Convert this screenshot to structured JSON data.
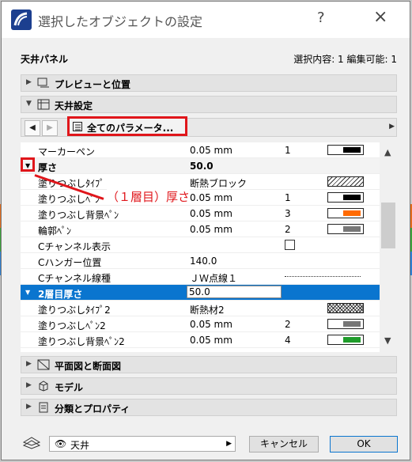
{
  "window": {
    "title": "選択したオブジェクトの設定",
    "help_label": "?",
    "close_label": "×"
  },
  "header": {
    "panel_name": "天井パネル",
    "selection_info": "選択内容: 1 編集可能: 1"
  },
  "sections": {
    "preview": "プレビューと位置",
    "ceiling_settings": "天井設定",
    "plan_section": "平面図と断面図",
    "model": "モデル",
    "classification": "分類とプロパティ"
  },
  "nav": {
    "all_params": "全てのパラメータ..."
  },
  "params": [
    {
      "name": "マーカーペン",
      "value": "0.05 mm",
      "num": "1",
      "swatch": "#000000"
    },
    {
      "name": "厚さ",
      "value": "50.0",
      "num": "",
      "swatch": ""
    },
    {
      "name": "塗りつぶしﾀｲﾌﾟ",
      "value": "断熱ブロック",
      "num": "",
      "swatch": "hatch"
    },
    {
      "name": "塗りつぶしﾍﾟﾝ",
      "value": "0.05 mm",
      "num": "1",
      "swatch": "#000000"
    },
    {
      "name": "塗りつぶし背景ﾍﾟﾝ",
      "value": "0.05 mm",
      "num": "3",
      "swatch": "#ff6a00"
    },
    {
      "name": "輪郭ﾍﾟﾝ",
      "value": "0.05 mm",
      "num": "2",
      "swatch": "#777777"
    },
    {
      "name": "Cチャンネル表示",
      "value": "",
      "num": "",
      "swatch": "checkbox"
    },
    {
      "name": "Cハンガー位置",
      "value": "140.0",
      "num": "",
      "swatch": ""
    },
    {
      "name": "Cチャンネル線種",
      "value": "ＪＷ点線１",
      "num": "",
      "swatch": "dots"
    },
    {
      "name": "2層目厚さ",
      "value": "50.0",
      "num": "",
      "swatch": ""
    },
    {
      "name": "塗りつぶしﾀｲﾌﾟ2",
      "value": "断熱材2",
      "num": "",
      "swatch": "cross"
    },
    {
      "name": "塗りつぶしﾍﾟﾝ2",
      "value": "0.05 mm",
      "num": "2",
      "swatch": "#777777"
    },
    {
      "name": "塗りつぶし背景ﾍﾟﾝ2",
      "value": "0.05 mm",
      "num": "4",
      "swatch": "#1f9c2b"
    }
  ],
  "annotation": "（１層目）厚さ",
  "footer": {
    "layer": "天井",
    "cancel": "キャンセル",
    "ok": "OK"
  }
}
